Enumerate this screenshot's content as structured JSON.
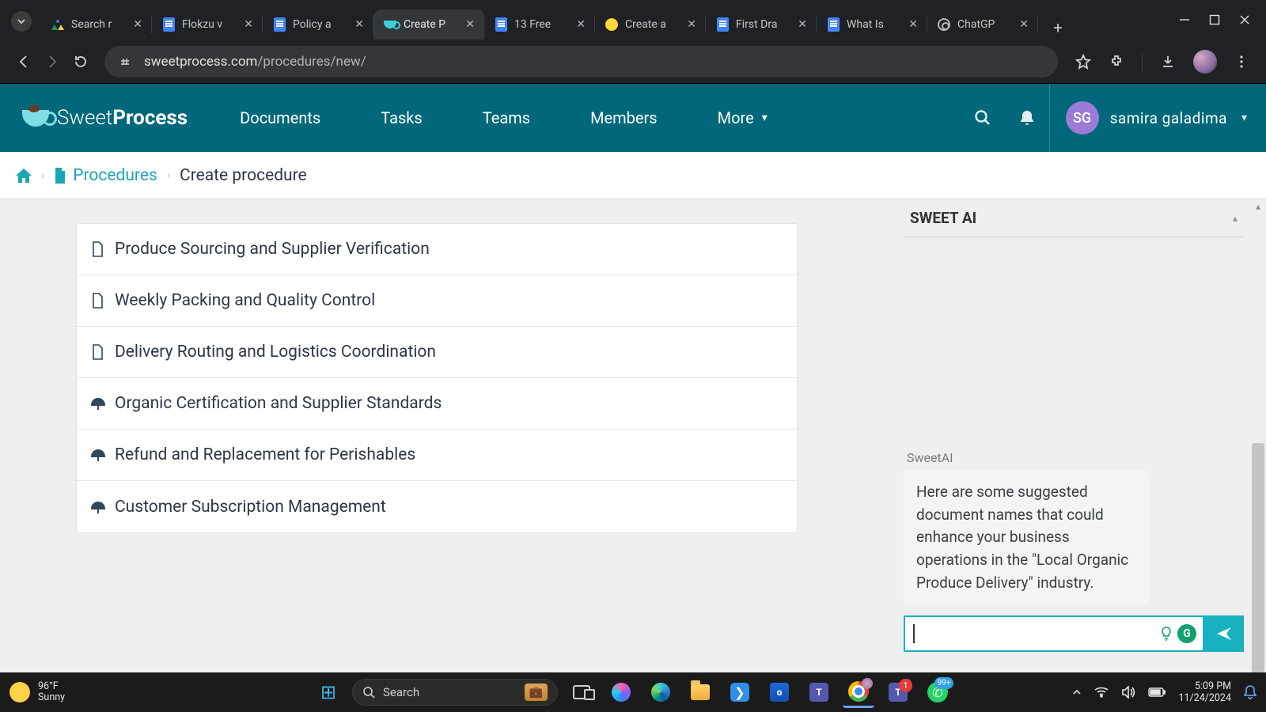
{
  "browser": {
    "tabs": [
      {
        "label": "Search r"
      },
      {
        "label": "Flokzu v"
      },
      {
        "label": "Policy a"
      },
      {
        "label": "Create P"
      },
      {
        "label": "13 Free"
      },
      {
        "label": "Create a"
      },
      {
        "label": "First Dra"
      },
      {
        "label": "What Is"
      },
      {
        "label": "ChatGP"
      }
    ],
    "active_tab_index": 3,
    "url_host": "sweetprocess.com",
    "url_path": "/procedures/new/"
  },
  "app": {
    "logo_prefix": "Sweet",
    "logo_suffix": "Process",
    "nav": [
      "Documents",
      "Tasks",
      "Teams",
      "Members",
      "More"
    ],
    "user_initials": "SG",
    "user_name": "samira galadima"
  },
  "breadcrumb": {
    "section": "Procedures",
    "current": "Create procedure"
  },
  "suggestions": [
    {
      "icon": "doc",
      "label": "Produce Sourcing and Supplier Verification"
    },
    {
      "icon": "doc",
      "label": "Weekly Packing and Quality Control"
    },
    {
      "icon": "doc",
      "label": "Delivery Routing and Logistics Coordination"
    },
    {
      "icon": "policy",
      "label": "Organic Certification and Supplier Standards"
    },
    {
      "icon": "policy",
      "label": "Refund and Replacement for Perishables"
    },
    {
      "icon": "policy",
      "label": "Customer Subscription Management"
    }
  ],
  "ai_panel": {
    "title": "SWEET AI",
    "sender": "SweetAI",
    "message": "Here are some suggested document names that could enhance your business operations in the \"Local Organic Produce Delivery\" industry."
  },
  "taskbar": {
    "weather_temp": "96°F",
    "weather_desc": "Sunny",
    "search_placeholder": "Search",
    "time": "5:09 PM",
    "date": "11/24/2024",
    "teams_badge": "1",
    "whatsapp_badge": "99+"
  }
}
